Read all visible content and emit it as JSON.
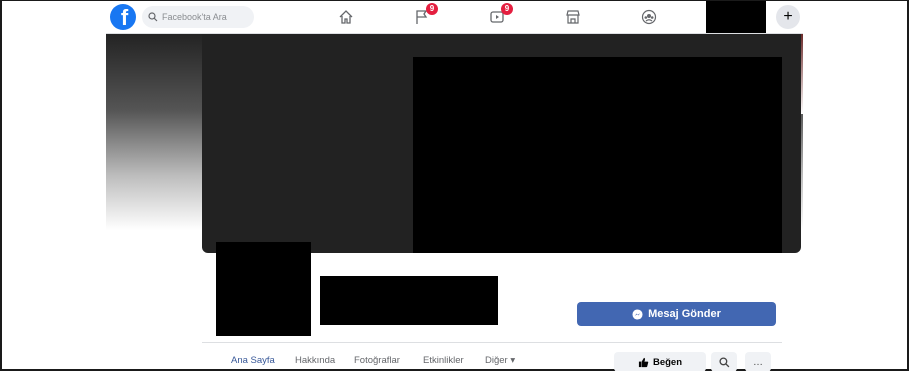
{
  "topbar": {
    "logo_letter": "f",
    "search_placeholder": "Facebook'ta Ara",
    "icons": [
      "home-icon",
      "flag-icon",
      "video-icon",
      "marketplace-icon",
      "groups-icon",
      "plus-icon"
    ],
    "flag_badge": "9",
    "video_badge": "9",
    "plus_label": "+"
  },
  "profile": {
    "message_button": "Mesaj Gönder"
  },
  "tabs": [
    {
      "label": "Ana Sayfa"
    },
    {
      "label": "Hakkında"
    },
    {
      "label": "Fotoğraflar"
    },
    {
      "label": "Etkinlikler"
    },
    {
      "label": "Diğer ▾"
    }
  ],
  "actions": {
    "like_label": "Beğen",
    "search_icon": "search-icon",
    "more_label": "…"
  },
  "colors": {
    "brand": "#1877f2",
    "badge": "#e41e3f",
    "message_button": "#4267b2",
    "active_tab": "#385898"
  }
}
